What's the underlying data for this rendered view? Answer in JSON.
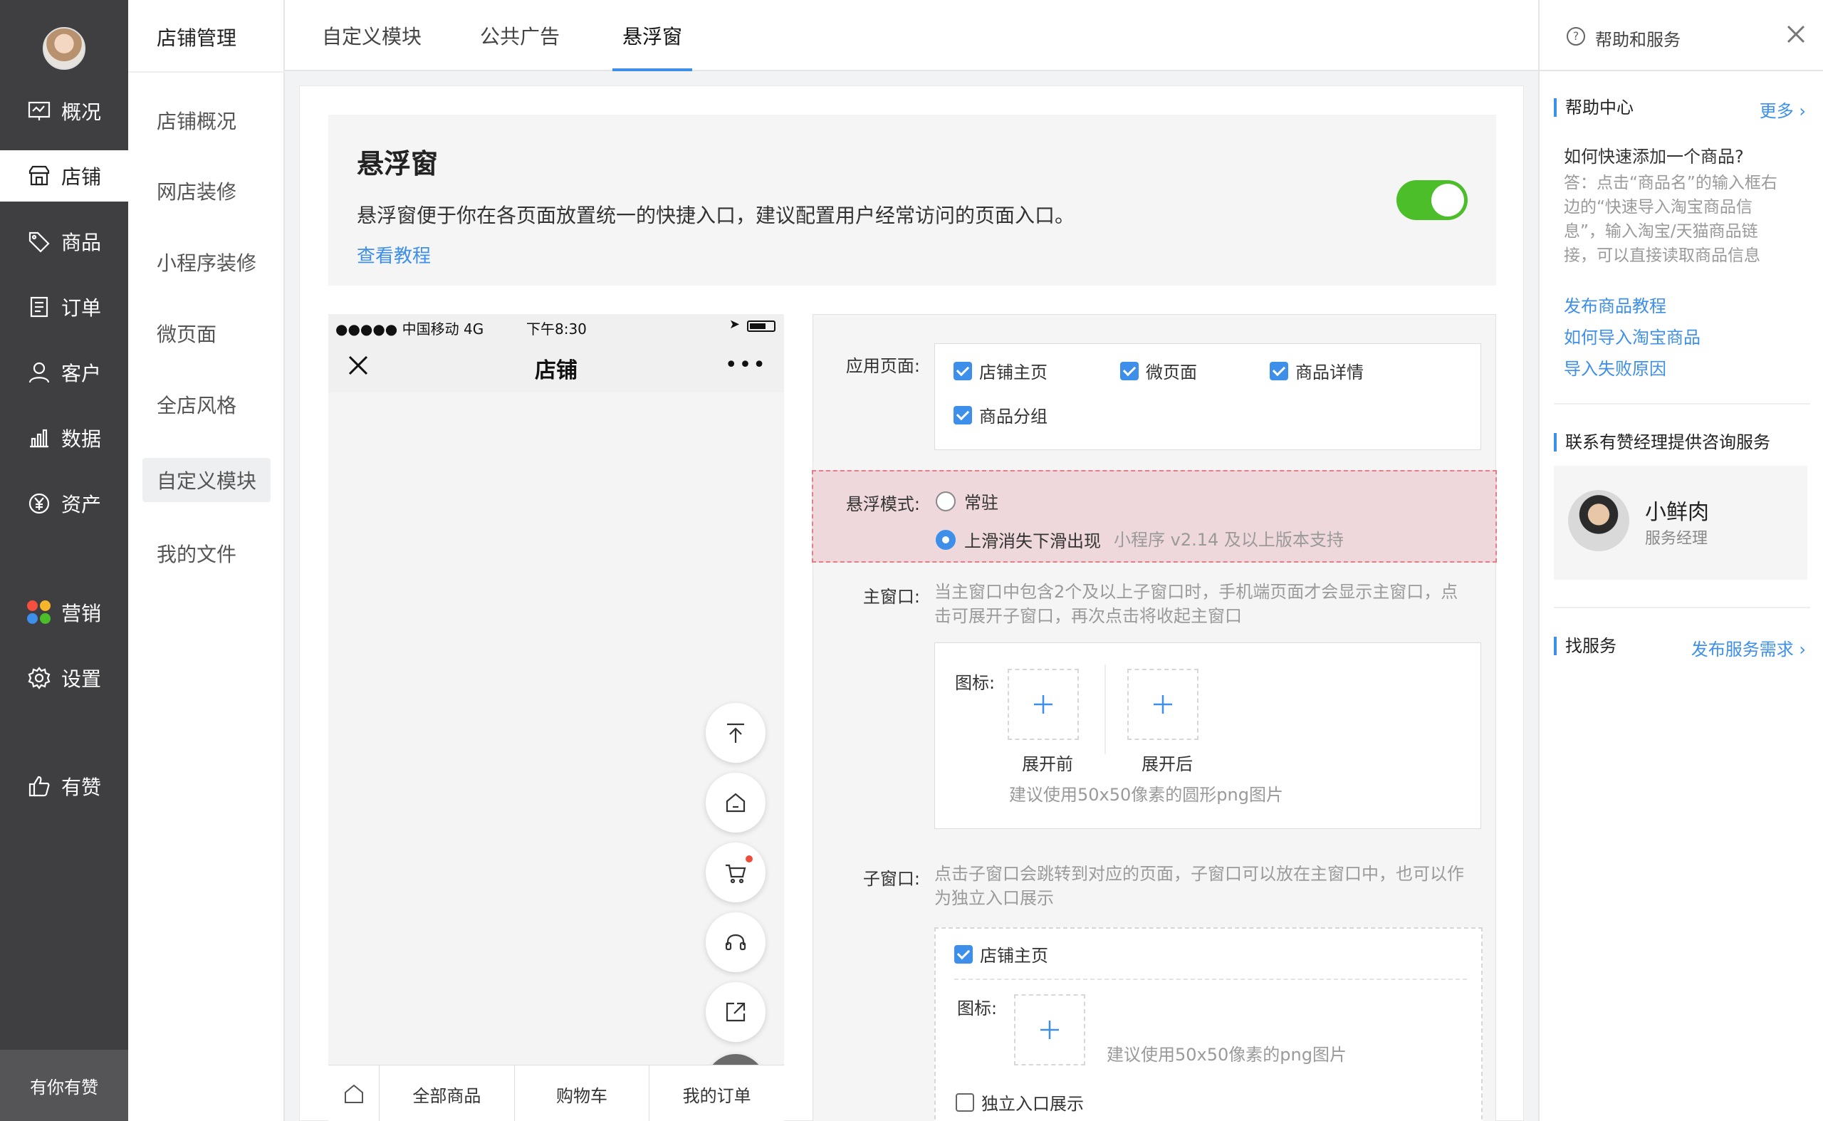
{
  "primary_nav": {
    "items": [
      {
        "label": "概况",
        "icon": "dashboard-icon"
      },
      {
        "label": "店铺",
        "icon": "store-icon"
      },
      {
        "label": "商品",
        "icon": "tag-icon"
      },
      {
        "label": "订单",
        "icon": "order-icon"
      },
      {
        "label": "客户",
        "icon": "user-icon"
      },
      {
        "label": "数据",
        "icon": "bar-chart-icon"
      },
      {
        "label": "资产",
        "icon": "yen-icon"
      },
      {
        "label": "营销",
        "icon": "petals-icon"
      },
      {
        "label": "设置",
        "icon": "gear-icon"
      },
      {
        "label": "有赞",
        "icon": "thumb-up-icon"
      }
    ],
    "active": "店铺",
    "footer": "有你有赞"
  },
  "secondary_nav": {
    "title": "店铺管理",
    "items": [
      "店铺概况",
      "网店装修",
      "小程序装修",
      "微页面",
      "全店风格",
      "自定义模块",
      "我的文件"
    ],
    "active": "自定义模块"
  },
  "tabs": {
    "items": [
      "自定义模块",
      "公共广告",
      "悬浮窗"
    ],
    "active": "悬浮窗"
  },
  "intro": {
    "title": "悬浮窗",
    "description": "悬浮窗便于你在各页面放置统一的快捷入口，建议配置用户经常访问的页面入口。",
    "link": "查看教程",
    "toggle_on": true,
    "toggle_color": "#4bbe2a"
  },
  "phone": {
    "status_left": "●●●●● 中国移动   4G",
    "time": "下午8:30",
    "title": "店铺",
    "more": "•••",
    "fabs": [
      "back-to-top-icon",
      "home-icon",
      "cart-icon",
      "headset-icon",
      "share-icon",
      "close-icon"
    ],
    "tabbar": [
      "全部商品",
      "购物车",
      "我的订单"
    ]
  },
  "settings": {
    "apply_pages": {
      "label": "应用页面:",
      "options": [
        {
          "label": "店铺主页",
          "checked": true
        },
        {
          "label": "微页面",
          "checked": true
        },
        {
          "label": "商品详情",
          "checked": true
        },
        {
          "label": "商品分组",
          "checked": true
        }
      ]
    },
    "float_mode": {
      "label": "悬浮模式:",
      "options": [
        {
          "label": "常驻",
          "selected": false
        },
        {
          "label": "上滑消失下滑出现",
          "selected": true
        }
      ],
      "note": "小程序 v2.14 及以上版本支持"
    },
    "main_window": {
      "label": "主窗口:",
      "hint_line1": "当主窗口中包含2个及以上子窗口时，手机端页面才会显示主窗口，点",
      "hint_line2": "击可展开子窗口，再次点击将收起主窗口",
      "icon_label": "图标:",
      "before": "展开前",
      "after": "展开后",
      "suggest": "建议使用50x50像素的圆形png图片"
    },
    "sub_window": {
      "label": "子窗口:",
      "hint_line1": "点击子窗口会跳转到对应的页面，子窗口可以放在主窗口中，也可以作",
      "hint_line2": "为独立入口展示",
      "page": "店铺主页",
      "icon_label": "图标:",
      "suggest": "建议使用50x50像素的png图片",
      "independent": "独立入口展示"
    }
  },
  "help": {
    "title": "帮助和服务",
    "help_center": "帮助中心",
    "more": "更多",
    "question": "如何快速添加一个商品?",
    "answer_lines": [
      "答：点击“商品名”的输入框右",
      "边的“快速导入淘宝商品信",
      "息”，输入淘宝/天猫商品链",
      "接，可以直接读取商品信息"
    ],
    "links": [
      "发布商品教程",
      "如何导入淘宝商品",
      "导入失败原因"
    ],
    "consult": "联系有赞经理提供咨询服务",
    "manager_name": "小鲜肉",
    "manager_role": "服务经理",
    "find_service": "找服务",
    "publish_demand": "发布服务需求"
  },
  "colors": {
    "accent": "#3d8fea",
    "nav_bg": "#3f3f42",
    "highlight": "#efd8db"
  }
}
